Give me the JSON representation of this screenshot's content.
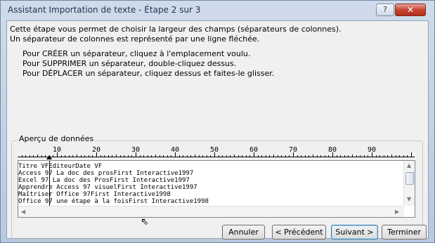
{
  "window": {
    "title": "Assistant Importation de texte - Étape 2 sur 3",
    "help_label": "?",
    "close_label": "✕"
  },
  "intro": {
    "line1": "Cette étape vous permet de choisir la largeur des champs (séparateurs de colonnes).",
    "line2": "Un séparateur de colonnes est représenté par une ligne fléchée."
  },
  "instructions": {
    "create": "Pour CRÉER un séparateur, cliquez à l'emplacement voulu.",
    "delete": "Pour SUPPRIMER un séparateur, double-cliquez dessus.",
    "move": "Pour DÉPLACER un séparateur, cliquez dessus et faites-le glisser."
  },
  "preview": {
    "label": "Aperçu de données",
    "ruler_numbers": [
      "10",
      "20",
      "30",
      "40",
      "50",
      "60",
      "70",
      "80",
      "90"
    ],
    "lines": [
      "Titre VFEditeurDate VF",
      "Access 97 La doc des prosFirst Interactive1997",
      "Excel 97 La doc des ProsFirst Interactive1997",
      "Apprendre Access 97 visuelFirst Interactive1997",
      "Maîtriser Office 97First Interactive1998",
      "Office 97 une étape à la foisFirst Interactive1998"
    ]
  },
  "buttons": {
    "cancel": "Annuler",
    "previous": "< Précédent",
    "next": "Suivant >",
    "finish": "Terminer"
  }
}
